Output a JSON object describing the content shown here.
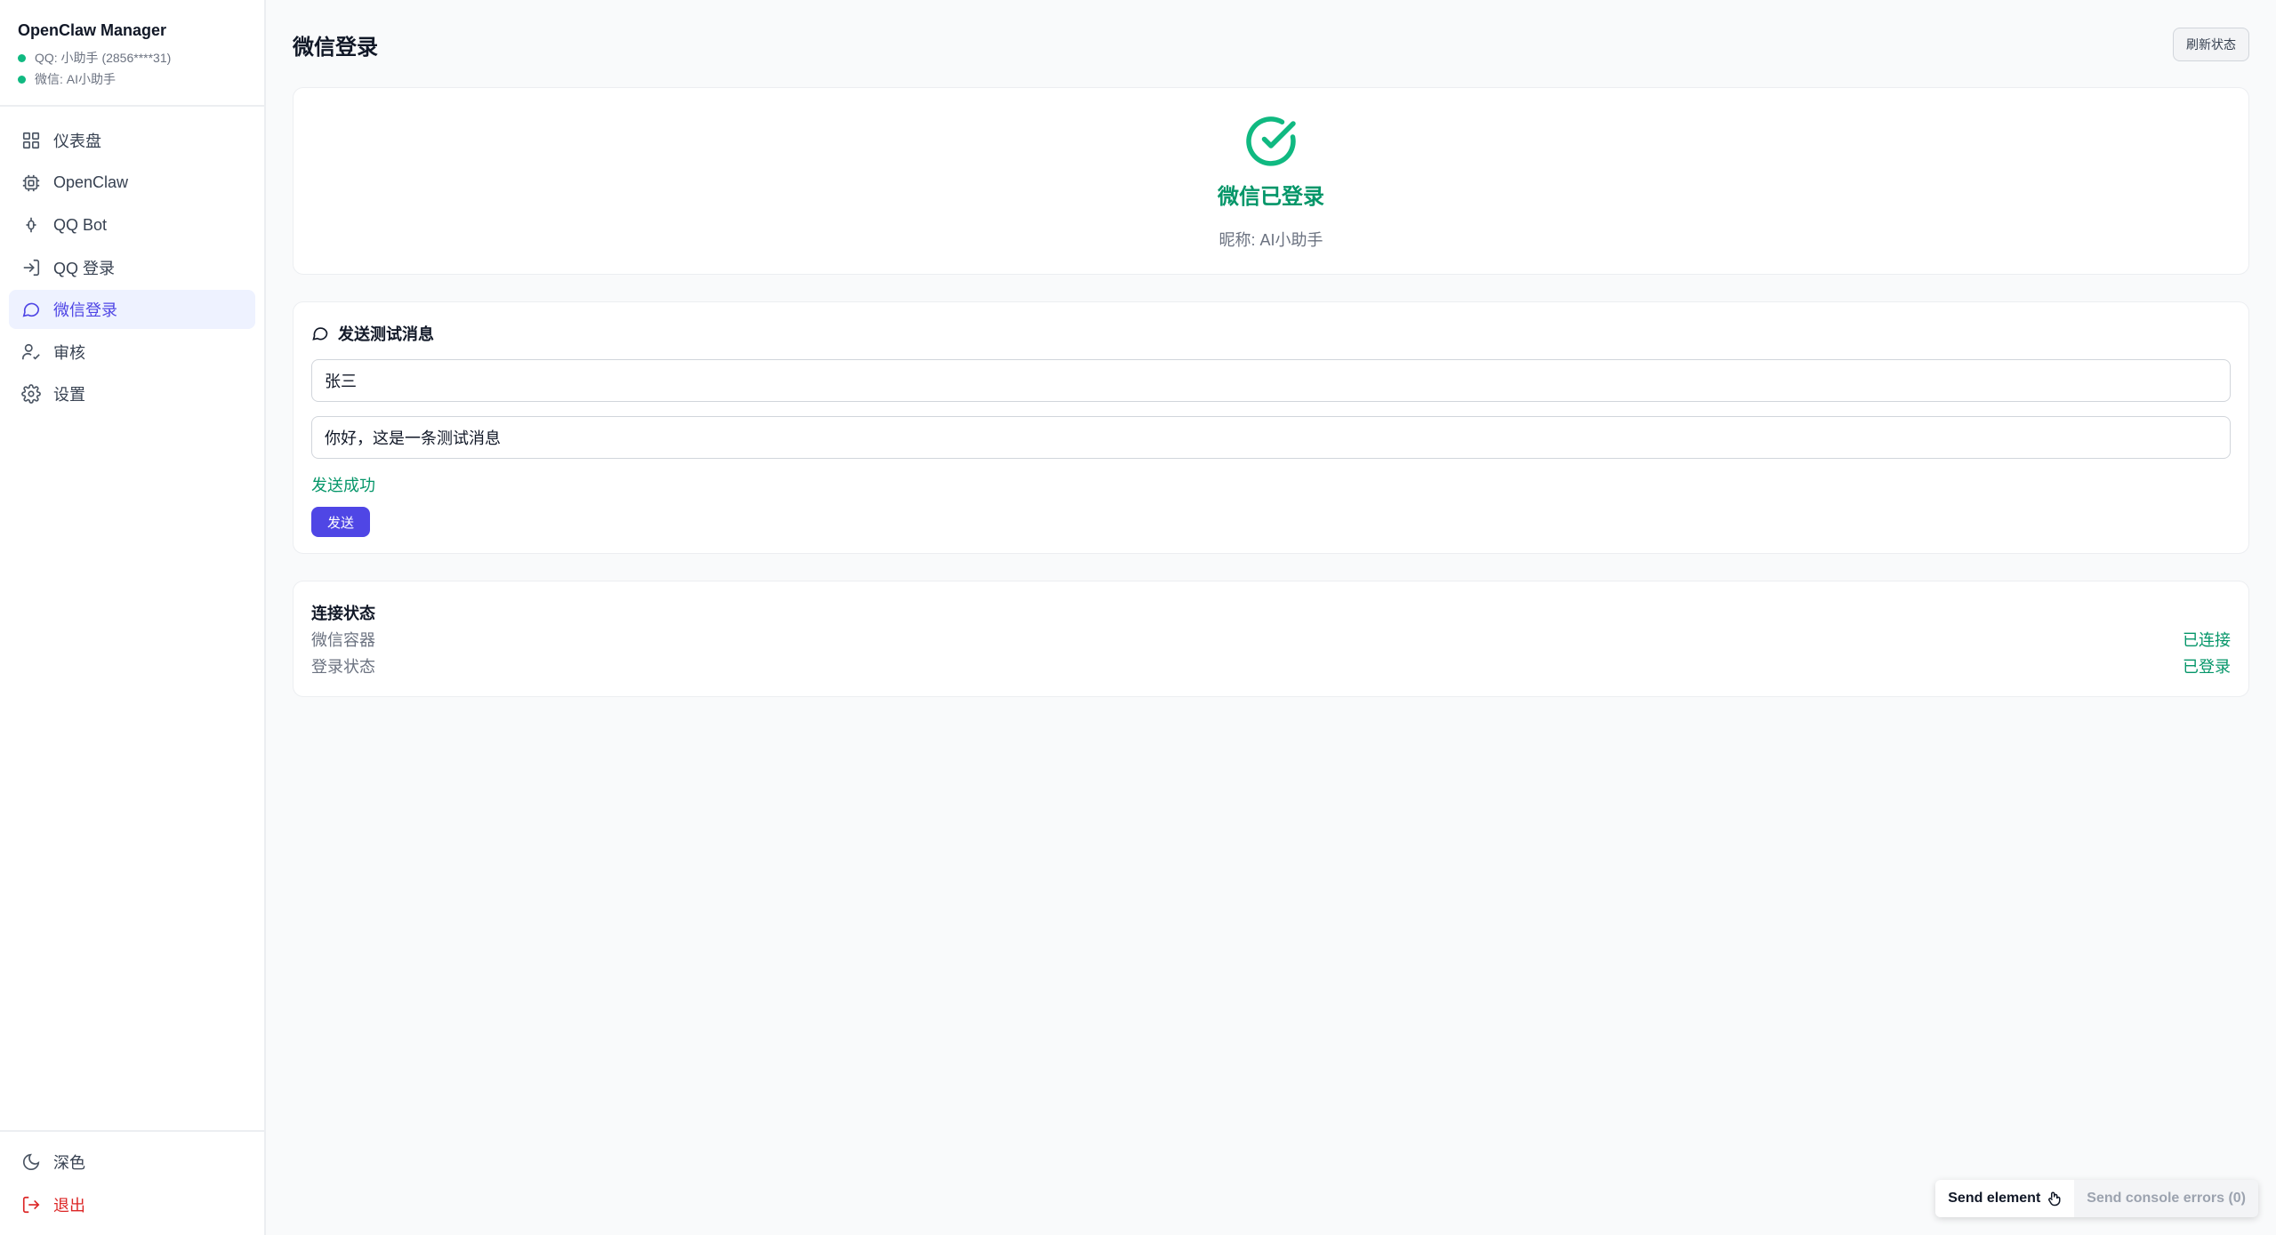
{
  "app": {
    "title": "OpenClaw Manager",
    "status": {
      "qq": "QQ: 小助手 (2856****31)",
      "wechat": "微信: AI小助手"
    }
  },
  "colors": {
    "accent": "#4f46e5",
    "success": "#059669",
    "danger": "#dc2626",
    "status_dot": "#10b981"
  },
  "sidebar": {
    "items": [
      {
        "label": "仪表盘",
        "icon": "grid-icon"
      },
      {
        "label": "OpenClaw",
        "icon": "cpu-icon"
      },
      {
        "label": "QQ Bot",
        "icon": "bot-icon"
      },
      {
        "label": "QQ 登录",
        "icon": "login-icon"
      },
      {
        "label": "微信登录",
        "icon": "message-circle-icon",
        "active": true
      },
      {
        "label": "审核",
        "icon": "user-check-icon"
      },
      {
        "label": "设置",
        "icon": "gear-icon"
      }
    ],
    "bottom": {
      "theme_label": "深色",
      "logout_label": "退出"
    }
  },
  "header": {
    "title": "微信登录",
    "refresh_label": "刷新状态"
  },
  "login_card": {
    "title": "微信已登录",
    "nickname": "昵称: AI小助手"
  },
  "send_card": {
    "title": "发送测试消息",
    "recipient_value": "张三",
    "message_value": "你好，这是一条测试消息",
    "result_text": "发送成功",
    "send_label": "发送"
  },
  "connection_card": {
    "title": "连接状态",
    "rows": [
      {
        "label": "微信容器",
        "value": "已连接"
      },
      {
        "label": "登录状态",
        "value": "已登录"
      }
    ]
  },
  "dev_widget": {
    "send_element_label": "Send element",
    "console_errors_label": "Send console errors (0)"
  }
}
